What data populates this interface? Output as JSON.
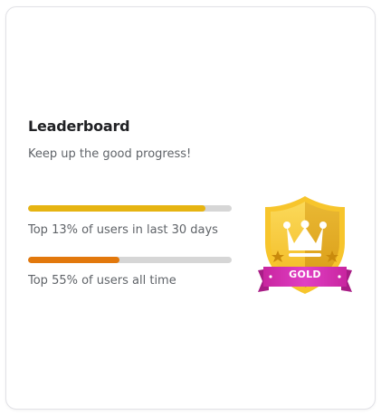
{
  "card": {
    "title": "Leaderboard",
    "subtitle": "Keep up the good progress!"
  },
  "stats": [
    {
      "label": "Top 13% of users in last 30 days",
      "progress": 0.87,
      "color": "#e6b412"
    },
    {
      "label": "Top 55% of users all time",
      "progress": 0.45,
      "color": "#e2780c"
    }
  ],
  "badge": {
    "label": "GOLD",
    "icon": "gold-crown-shield-badge",
    "colors": {
      "shield": "#f2c230",
      "ribbon": "#cf2fb3"
    }
  }
}
